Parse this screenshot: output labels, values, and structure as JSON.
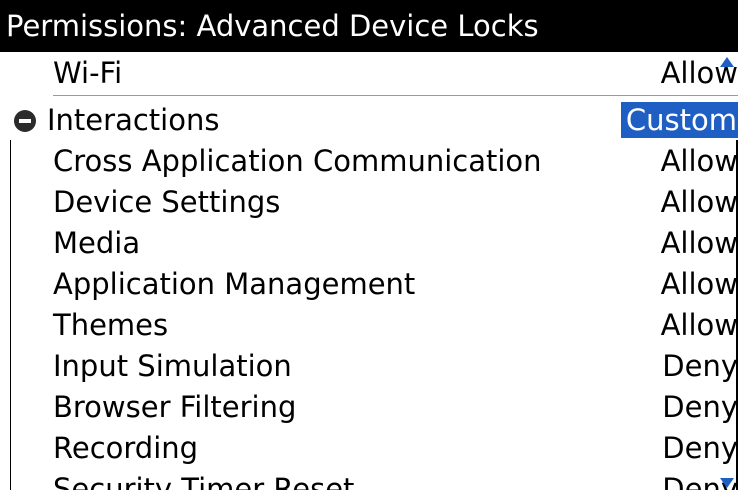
{
  "header": {
    "title": "Permissions: Advanced Device Locks"
  },
  "list": {
    "rows": [
      {
        "label": "Wi-Fi",
        "value": "Allow"
      },
      {
        "label": "Interactions",
        "value": "Custom"
      },
      {
        "label": "Cross Application Communication",
        "value": "Allow"
      },
      {
        "label": "Device Settings",
        "value": "Allow"
      },
      {
        "label": "Media",
        "value": "Allow"
      },
      {
        "label": "Application Management",
        "value": "Allow"
      },
      {
        "label": "Themes",
        "value": "Allow"
      },
      {
        "label": "Input Simulation",
        "value": "Deny"
      },
      {
        "label": "Browser Filtering",
        "value": "Deny"
      },
      {
        "label": "Recording",
        "value": "Deny"
      },
      {
        "label": "Security Timer Reset",
        "value": "Deny"
      }
    ]
  },
  "colors": {
    "title_bg": "#000000",
    "title_fg": "#ffffff",
    "selection_bg": "#1f5fc4",
    "scroll_arrow": "#1f5fc4"
  },
  "icons": {
    "group_toggle": "collapse-minus-icon",
    "scroll_up": "scroll-up-arrow-icon",
    "scroll_down": "scroll-down-arrow-icon"
  }
}
